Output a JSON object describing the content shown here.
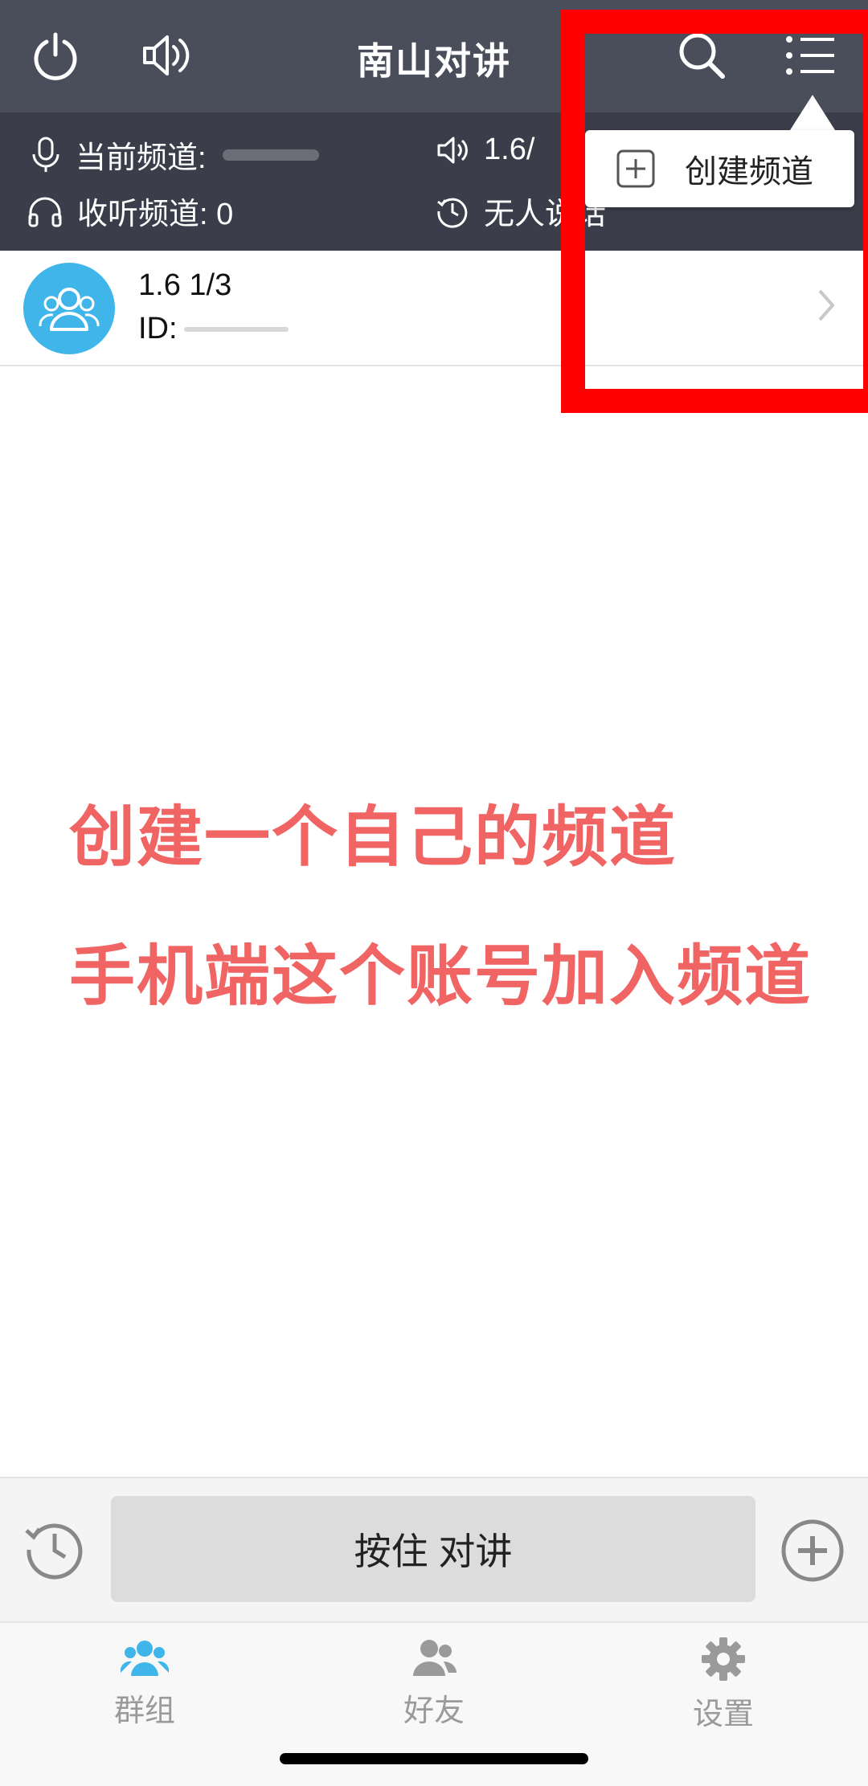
{
  "header": {
    "title": "南山对讲",
    "icons": [
      "power-icon",
      "speaker-icon",
      "search-icon",
      "menu-list-icon"
    ]
  },
  "info": {
    "current_channel_label": "当前频道:",
    "listen_channel_label": "收听频道: 0",
    "volume_text": "1.6/",
    "talk_status": "无人说话"
  },
  "channel": {
    "name": "1.6 1/3",
    "id_label": "ID:"
  },
  "popup": {
    "create_channel": "创建频道"
  },
  "annotation": {
    "line1": "创建一个自己的频道",
    "line2": "手机端这个账号加入频道"
  },
  "ptt": {
    "label": "按住 对讲"
  },
  "tabs": [
    {
      "label": "群组",
      "icon": "group-icon"
    },
    {
      "label": "好友",
      "icon": "friends-icon"
    },
    {
      "label": "设置",
      "icon": "gear-icon"
    }
  ],
  "colors": {
    "topbar": "#4a4d5a",
    "infobar": "#3b3e4a",
    "accent_blue": "#3fb5ea",
    "annotation_red": "#f06464",
    "highlight_box": "#ff0000"
  }
}
